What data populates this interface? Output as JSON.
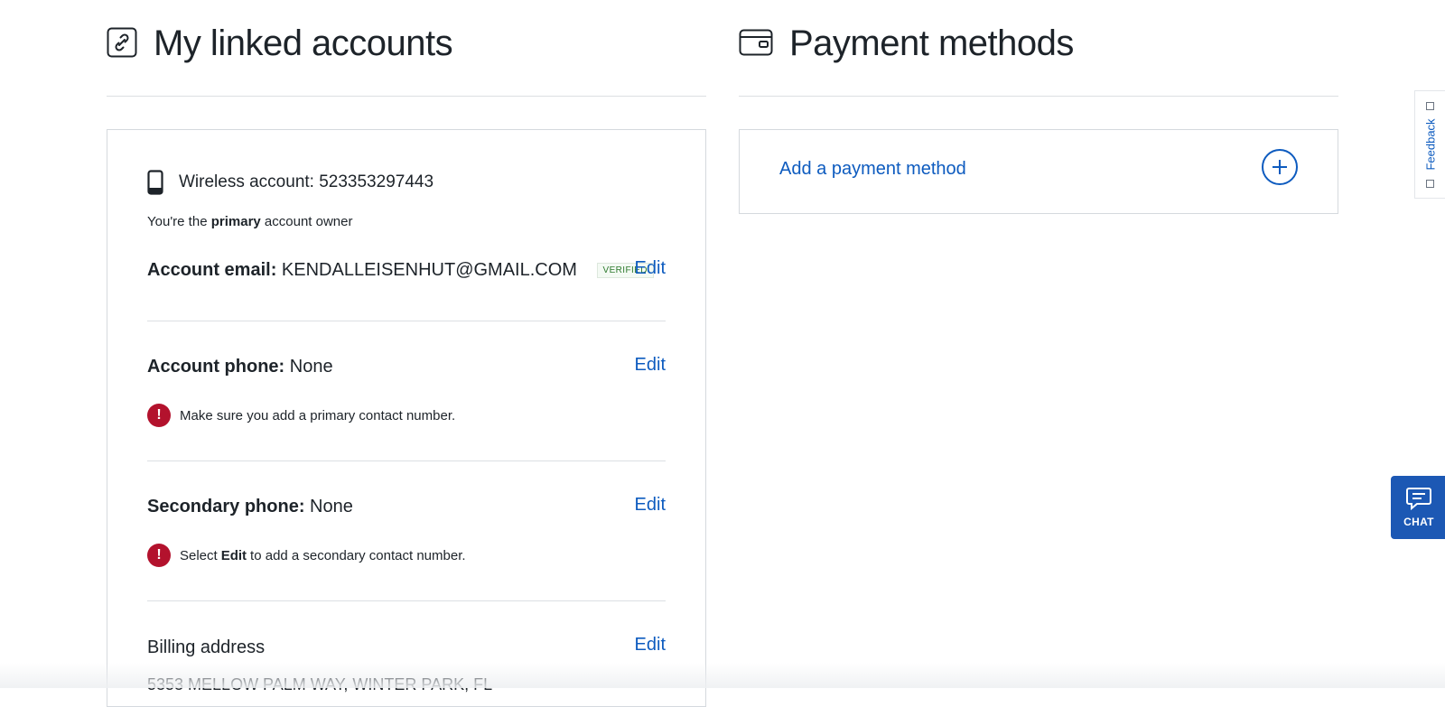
{
  "linked_accounts": {
    "title": "My linked accounts",
    "icon": "link-icon",
    "account": {
      "icon": "mobile-phone-icon",
      "title": "Wireless account: 523353297443",
      "owner_prefix": "You're the",
      "owner_role": "primary",
      "owner_suffix": "account owner",
      "email": {
        "label": "Account email:",
        "value": "KENDALLEISENHUT@GMAIL.COM",
        "badge": "VERIFIED",
        "edit_label": "Edit"
      },
      "phone": {
        "label": "Account phone:",
        "value": "None",
        "edit_label": "Edit",
        "warning": "Make sure you add a primary contact number."
      },
      "secondary_phone": {
        "label": "Secondary phone:",
        "value": "None",
        "edit_label": "Edit",
        "warning_prefix": "Select",
        "warning_bold": "Edit",
        "warning_suffix": "to add a secondary contact number."
      },
      "billing": {
        "label": "Billing address",
        "edit_label": "Edit",
        "value": "5353 MELLOW PALM WAY, WINTER PARK, FL"
      }
    }
  },
  "payment_methods": {
    "title": "Payment methods",
    "icon": "wallet-icon",
    "add_label": "Add a payment method",
    "add_icon": "plus-circle-icon"
  },
  "feedback": {
    "label": "Feedback",
    "icon": "external-link-icon"
  },
  "chat": {
    "label": "CHAT",
    "icon": "chat-bubble-icon"
  },
  "colors": {
    "link": "#0d5bbf",
    "error": "#b3122d",
    "verified": "#2d7a2d",
    "chat_bg": "#1c58b4"
  }
}
